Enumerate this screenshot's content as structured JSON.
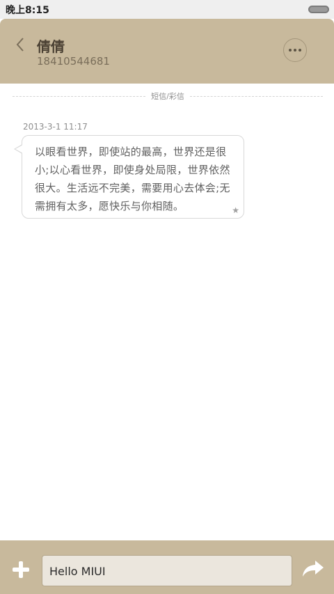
{
  "status_bar": {
    "time": "晚上8:15"
  },
  "header": {
    "contact_name": "倩倩",
    "contact_number": "18410544681"
  },
  "divider_label": "短信/彩信",
  "messages": [
    {
      "timestamp": "2013-3-1 11:17",
      "text": "以眼看世界，即使站的最高，世界还是很小;以心看世界，即使身处局限，世界依然很大。生活远不完美，需要用心去体会;无需拥有太多，愿快乐与你相随。",
      "starred": true
    }
  ],
  "compose": {
    "input_value": "Hello MIUI"
  },
  "icons": {
    "back": "chevron-left-icon",
    "more": "more-dots-icon",
    "star": "star-icon",
    "add": "plus-icon",
    "send": "send-arrow-icon",
    "battery": "battery-icon"
  },
  "colors": {
    "header_bg": "#c8b99c",
    "bottom_bg": "#c8b99c",
    "input_bg": "#ebe6dd",
    "status_bg": "#efefef"
  }
}
